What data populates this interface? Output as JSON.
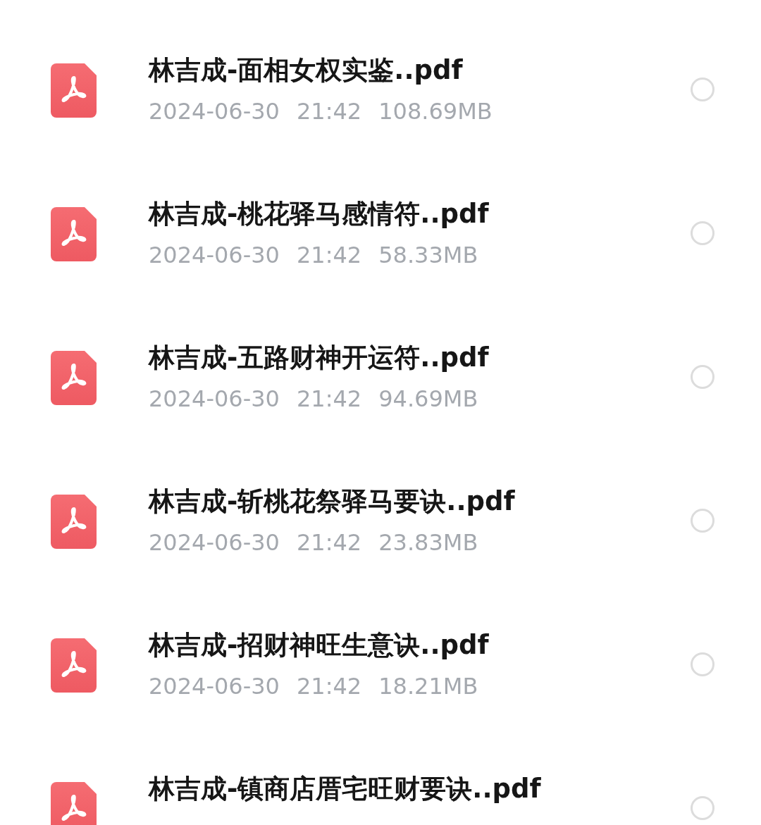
{
  "files": [
    {
      "name": "林吉成-面相女权实鉴..pdf",
      "date": "2024-06-30",
      "time": "21:42",
      "size": "108.69MB",
      "selected": false
    },
    {
      "name": "林吉成-桃花驿马感情符..pdf",
      "date": "2024-06-30",
      "time": "21:42",
      "size": "58.33MB",
      "selected": false
    },
    {
      "name": "林吉成-五路财神开运符..pdf",
      "date": "2024-06-30",
      "time": "21:42",
      "size": "94.69MB",
      "selected": false
    },
    {
      "name": "林吉成-斩桃花祭驿马要诀..pdf",
      "date": "2024-06-30",
      "time": "21:42",
      "size": "23.83MB",
      "selected": false
    },
    {
      "name": "林吉成-招财神旺生意诀..pdf",
      "date": "2024-06-30",
      "time": "21:42",
      "size": "18.21MB",
      "selected": false
    },
    {
      "name": "林吉成-镇商店厝宅旺财要诀..pdf",
      "selected": false
    }
  ]
}
